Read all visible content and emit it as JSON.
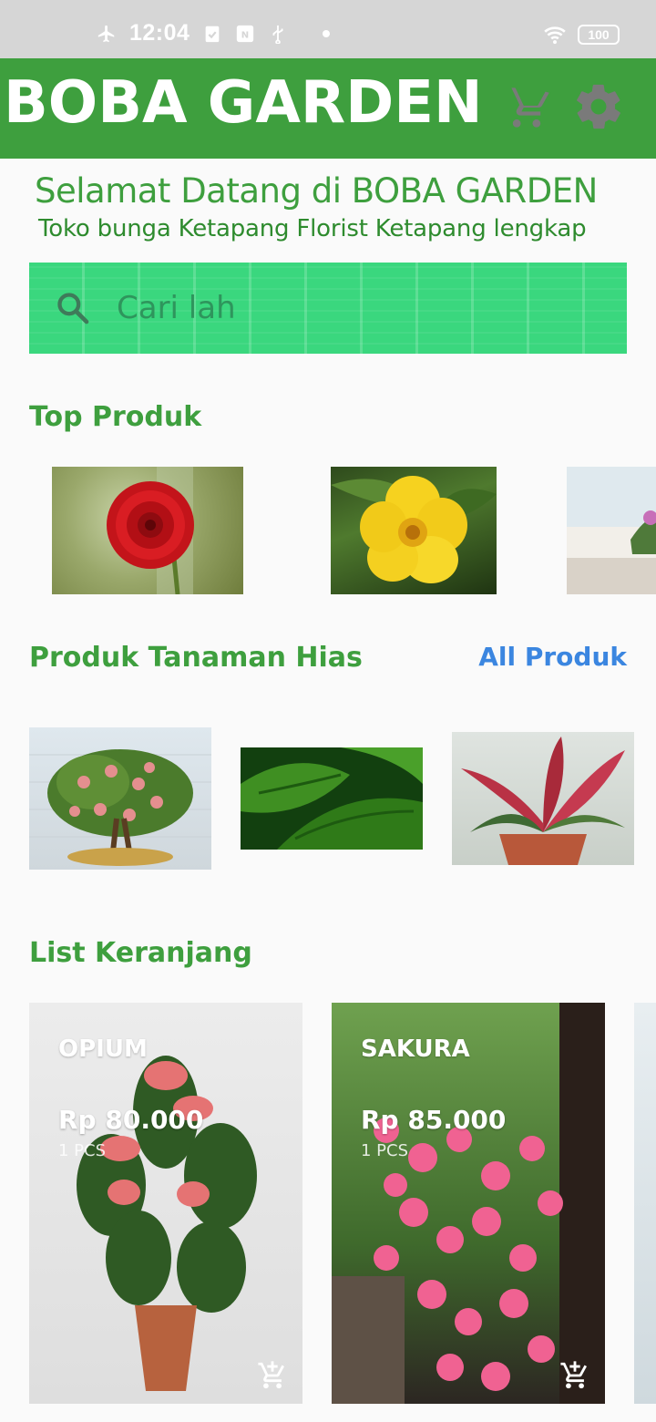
{
  "status_bar": {
    "time": "12:04",
    "battery": "100",
    "icons": [
      "airplane-icon",
      "clipboard-check-icon",
      "nfc-icon",
      "usb-icon",
      "wifi-icon"
    ]
  },
  "app_bar": {
    "title": "BOBA GARDEN",
    "cart_icon": "cart-icon",
    "settings_icon": "gear-icon",
    "background": "#3e9f3e"
  },
  "welcome": {
    "heading": "Selamat Datang di BOBA GARDEN",
    "subheading": "Toko bunga Ketapang Florist Ketapang lengkap"
  },
  "search": {
    "placeholder": "Cari lah",
    "icon": "search-icon"
  },
  "top_products": {
    "title": "Top Produk",
    "items": [
      {
        "image": "red-dahlia-photo"
      },
      {
        "image": "yellow-allamanda-photo"
      },
      {
        "image": "violet-potted-flower-photo"
      }
    ]
  },
  "ornamental": {
    "title": "Produk Tanaman Hias",
    "all_link": "All Produk",
    "items": [
      {
        "image": "fruit-bonsai-photo"
      },
      {
        "image": "green-leaves-photo"
      },
      {
        "image": "red-aglaonema-photo"
      }
    ]
  },
  "cart_list": {
    "title": "List Keranjang",
    "items": [
      {
        "name": "OPIUM",
        "price": "Rp 80.000",
        "qty": "1 PCS",
        "image": "anthurium-pot-photo"
      },
      {
        "name": "SAKURA",
        "price": "Rp 85.000",
        "qty": "1 PCS",
        "image": "pink-petunia-photo"
      }
    ]
  },
  "colors": {
    "primary_green": "#3e9f3e",
    "search_green": "#3ad77e",
    "link_blue": "#3b86e0"
  }
}
